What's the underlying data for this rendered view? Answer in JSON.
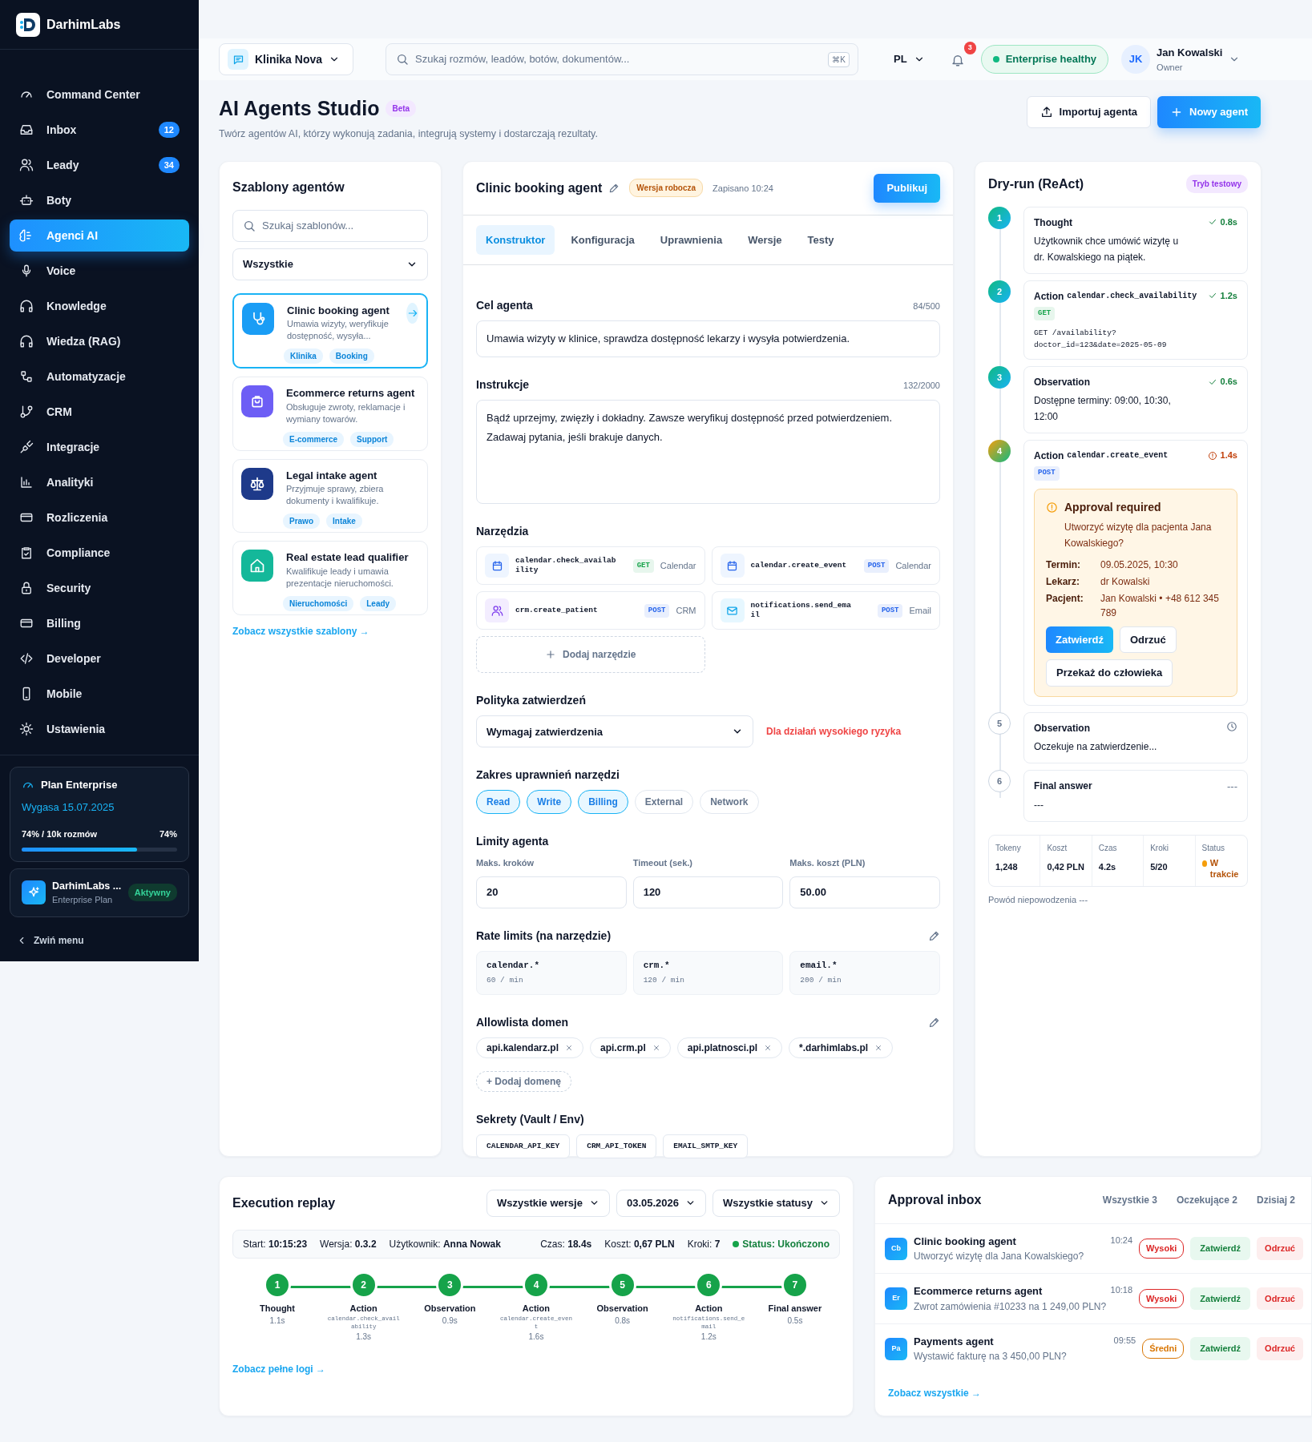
{
  "sidebar": {
    "brand": "DarhimLabs",
    "items": [
      {
        "label": "Command Center",
        "selected": false
      },
      {
        "label": "Inbox",
        "badge": "12",
        "selected": false
      },
      {
        "label": "Leady",
        "badge": "34",
        "selected": false
      },
      {
        "label": "Boty",
        "selected": false
      },
      {
        "label": "Agenci AI",
        "selected": true
      },
      {
        "label": "Voice",
        "selected": false
      },
      {
        "label": "Knowledge",
        "selected": false
      },
      {
        "label": "Wiedza (RAG)",
        "selected": false
      },
      {
        "label": "Automatyzacje",
        "selected": false
      },
      {
        "label": "CRM",
        "selected": false
      },
      {
        "label": "Integracje",
        "selected": false
      },
      {
        "label": "Analityki",
        "selected": false
      },
      {
        "label": "Rozliczenia",
        "selected": false
      },
      {
        "label": "Compliance",
        "selected": false
      },
      {
        "label": "Security",
        "selected": false
      },
      {
        "label": "Billing",
        "selected": false
      },
      {
        "label": "Developer",
        "selected": false
      },
      {
        "label": "Mobile",
        "selected": false
      },
      {
        "label": "Ustawienia",
        "selected": false
      }
    ],
    "plan": {
      "title": "Plan Enterprise",
      "expires": "Wygasa 15.07.2025",
      "usage": "74% / 10k rozmów",
      "percent": "74%",
      "level": 0.74
    },
    "workspace": {
      "name": "DarhimLabs ...",
      "plan": "Enterprise Plan",
      "status": "Aktywny"
    },
    "collapse": "Zwiń menu"
  },
  "topbar": {
    "workspace": "Klinika Nova",
    "search": {
      "placeholder": "Szukaj rozmów, leadów, botów, dokumentów...",
      "shortcut": "⌘K"
    },
    "language": "PL",
    "notifications": "3",
    "health": "Enterprise healthy",
    "user": {
      "initials": "JK",
      "name": "Jan Kowalski",
      "role": "Owner"
    }
  },
  "header": {
    "title": "AI Agents Studio",
    "badge": "Beta",
    "subtitle": "Twórz agentów AI, którzy wykonują zadania, integrują systemy i dostarczają rezultaty.",
    "buttons": [
      {
        "label": "Importuj agenta",
        "kind": "secondary"
      },
      {
        "label": "Nowy agent",
        "kind": "primary"
      }
    ]
  },
  "templates": {
    "title": "Szablony agentów",
    "search": {
      "placeholder": "Szukaj szablonów..."
    },
    "filter": "Wszystkie",
    "items": [
      {
        "title": "Clinic booking agent",
        "description": "Umawia wizyty, weryfikuje dostępność, wysyła...",
        "tags": [
          "Klinika",
          "Booking"
        ],
        "color": "#1a9df5",
        "selected": true
      },
      {
        "title": "Ecommerce returns agent",
        "description": "Obsługuje zwroty, reklamacje i wymiany towarów.",
        "tags": [
          "E-commerce",
          "Support"
        ],
        "color": "#6d5ef5",
        "selected": false
      },
      {
        "title": "Legal intake agent",
        "description": "Przyjmuje sprawy, zbiera dokumenty i kwalifikuje.",
        "tags": [
          "Prawo",
          "Intake"
        ],
        "color": "#1e3a8a",
        "selected": false
      },
      {
        "title": "Real estate lead qualifier",
        "description": "Kwalifikuje leady i umawia prezentacje nieruchomości.",
        "tags": [
          "Nieruchomości",
          "Leady"
        ],
        "color": "#14b89a",
        "selected": false
      }
    ],
    "link": "Zobacz wszystkie szablony →"
  },
  "editor": {
    "title": "Clinic booking agent",
    "status": "Wersja robocza",
    "saved": "Zapisano 10:24",
    "publish": "Publikuj",
    "tabs": [
      {
        "label": "Konstruktor",
        "selected": true
      },
      {
        "label": "Konfiguracja",
        "selected": false
      },
      {
        "label": "Uprawnienia",
        "selected": false
      },
      {
        "label": "Wersje",
        "selected": false
      },
      {
        "label": "Testy",
        "selected": false
      }
    ],
    "goal": {
      "label": "Cel agenta",
      "counter": "84/500",
      "value": "Umawia wizyty w klinice, sprawdza dostępność lekarzy i wysyła potwierdzenia."
    },
    "instructions": {
      "label": "Instrukcje",
      "counter": "132/2000",
      "value": "Bądź uprzejmy, zwięzły i dokładny. Zawsze weryfikuj dostępność przed potwierdzeniem.\nZadawaj pytania, jeśli brakuje danych."
    },
    "tools": {
      "label": "Narzędzia",
      "items": [
        {
          "name": "calendar.check_availability",
          "method": "GET",
          "color": "#16a34a",
          "service": "Calendar"
        },
        {
          "name": "calendar.create_event",
          "method": "POST",
          "color": "#2563eb",
          "service": "Calendar"
        },
        {
          "name": "crm.create_patient",
          "method": "POST",
          "color": "#2563eb",
          "service": "CRM"
        },
        {
          "name": "notifications.send_email",
          "method": "POST",
          "color": "#2563eb",
          "service": "Email"
        }
      ],
      "add": "Dodaj narzędzie"
    },
    "policy": {
      "label": "Polityka zatwierdzeń",
      "value": "Wymagaj zatwierdzenia",
      "note": "Dla działań wysokiego ryzyka"
    },
    "scopes": {
      "label": "Zakres uprawnień narzędzi",
      "items": [
        {
          "label": "Read",
          "selected": true
        },
        {
          "label": "Write",
          "selected": true
        },
        {
          "label": "Billing",
          "selected": true
        },
        {
          "label": "External",
          "selected": false
        },
        {
          "label": "Network",
          "selected": false
        }
      ]
    },
    "limits": {
      "label": "Limity agenta",
      "fields": [
        {
          "label": "Maks. kroków",
          "value": "20"
        },
        {
          "label": "Timeout (sek.)",
          "value": "120"
        },
        {
          "label": "Maks. koszt (PLN)",
          "value": "50.00"
        }
      ]
    },
    "rate_limits": {
      "label": "Rate limits (na narzędzie)",
      "items": [
        {
          "pattern": "calendar.*",
          "rate": "60 / min"
        },
        {
          "pattern": "crm.*",
          "rate": "120 / min"
        },
        {
          "pattern": "email.*",
          "rate": "200 / min"
        }
      ]
    },
    "domains": {
      "label": "Allowlista domen",
      "items": [
        "api.kalendarz.pl",
        "api.crm.pl",
        "api.platnosci.pl",
        "*.darhimlabs.pl"
      ],
      "add": "+ Dodaj domenę"
    },
    "secrets": {
      "label": "Sekrety (Vault / Env)",
      "items": [
        "CALENDAR_API_KEY",
        "CRM_API_TOKEN",
        "EMAIL_SMTP_KEY"
      ]
    }
  },
  "dry_run": {
    "title": "Dry-run (ReAct)",
    "badge": "Tryb testowy",
    "steps": [
      {
        "number": "1",
        "title": "Thought",
        "duration": "0.8s",
        "kind": "done",
        "text": "Użytkownik chce umówić wizytę u dr. Kowalskiego na piątek."
      },
      {
        "number": "2",
        "title": "Action",
        "code": "calendar.check_availability",
        "method": {
          "label": "GET",
          "color": "#16a34a"
        },
        "duration": "1.2s",
        "kind": "done",
        "request": "GET /availability?\ndoctor_id=123&date=2025-05-09"
      },
      {
        "number": "3",
        "title": "Observation",
        "duration": "0.6s",
        "kind": "done",
        "text": "Dostępne terminy: 09:00, 10:30, 12:00"
      },
      {
        "number": "4",
        "title": "Action",
        "code": "calendar.create_event",
        "method": {
          "label": "POST",
          "color": "#2563eb"
        },
        "duration": "1.4s",
        "kind": "waiting",
        "approval": {
          "title": "Approval required",
          "question": "Utworzyć wizytę dla pacjenta Jana Kowalskiego?",
          "details": [
            {
              "label": "Termin:",
              "value": "09.05.2025, 10:30"
            },
            {
              "label": "Lekarz:",
              "value": "dr Kowalski"
            },
            {
              "label": "Pacjent:",
              "value": "Jan Kowalski • +48 612 345 789"
            }
          ],
          "actions": [
            {
              "label": "Zatwierdź",
              "kind": "primary"
            },
            {
              "label": "Odrzuć",
              "kind": "outline"
            },
            {
              "label": "Przekaż do człowieka",
              "kind": "outline"
            }
          ]
        }
      },
      {
        "number": "5",
        "title": "Observation",
        "kind": "pending",
        "text": "Oczekuje na zatwierdzenie..."
      },
      {
        "number": "6",
        "title": "Final answer",
        "duration": "---",
        "kind": "pending",
        "text": "---"
      }
    ],
    "stats": [
      {
        "label": "Tokeny",
        "value": "1,248"
      },
      {
        "label": "Koszt",
        "value": "0,42 PLN"
      },
      {
        "label": "Czas",
        "value": "4.2s"
      },
      {
        "label": "Kroki",
        "value": "5/20"
      },
      {
        "label": "Status",
        "value": "W trakcie",
        "color": "#f59e0b"
      }
    ],
    "footnote": "Powód niepowodzenia ---"
  },
  "replay": {
    "title": "Execution replay",
    "filters": [
      "Wszystkie wersje",
      "03.05.2026",
      "Wszystkie statusy"
    ],
    "left": [
      "Start: **10:15:23**",
      "Wersja: **0.3.2**",
      "Użytkownik: **Anna Nowak**"
    ],
    "right": [
      "Czas: **18.4s**",
      "Koszt: **0,67 PLN**",
      "Kroki: **7**"
    ],
    "status": "Status: Ukończono",
    "steps": [
      {
        "number": "1",
        "title": "Thought",
        "duration": "1.1s"
      },
      {
        "number": "2",
        "title": "Action",
        "code": "calendar.check_availability",
        "duration": "1.3s"
      },
      {
        "number": "3",
        "title": "Observation",
        "duration": "0.9s"
      },
      {
        "number": "4",
        "title": "Action",
        "code": "calendar.create_event",
        "duration": "1.6s"
      },
      {
        "number": "5",
        "title": "Observation",
        "duration": "0.8s"
      },
      {
        "number": "6",
        "title": "Action",
        "code": "notifications.send_email",
        "duration": "1.2s"
      },
      {
        "number": "7",
        "title": "Final answer",
        "duration": "0.5s"
      }
    ],
    "link": "Zobacz pełne logi →"
  },
  "approval_inbox": {
    "title": "Approval inbox",
    "filters": [
      "Wszystkie 3",
      "Oczekujące 2",
      "Dzisiaj 2"
    ],
    "items": [
      {
        "initials": "Cb",
        "title": "Clinic booking agent",
        "time": "10:24",
        "text": "Utworzyć wizytę dla Jana Kowalskiego?",
        "priority": "Wysoki",
        "color": "#dc2626",
        "approve": "Zatwierdź",
        "reject": "Odrzuć"
      },
      {
        "initials": "Er",
        "title": "Ecommerce returns agent",
        "time": "10:18",
        "text": "Zwrot zamówienia #10233 na 1 249,00 PLN?",
        "priority": "Wysoki",
        "color": "#dc2626",
        "approve": "Zatwierdź",
        "reject": "Odrzuć"
      },
      {
        "initials": "Pa",
        "title": "Payments agent",
        "time": "09:55",
        "text": "Wystawić fakturę na 3 450,00 PLN?",
        "priority": "Średni",
        "color": "#d97706",
        "approve": "Zatwierdź",
        "reject": "Odrzuć"
      }
    ],
    "link": "Zobacz wszystkie →"
  }
}
